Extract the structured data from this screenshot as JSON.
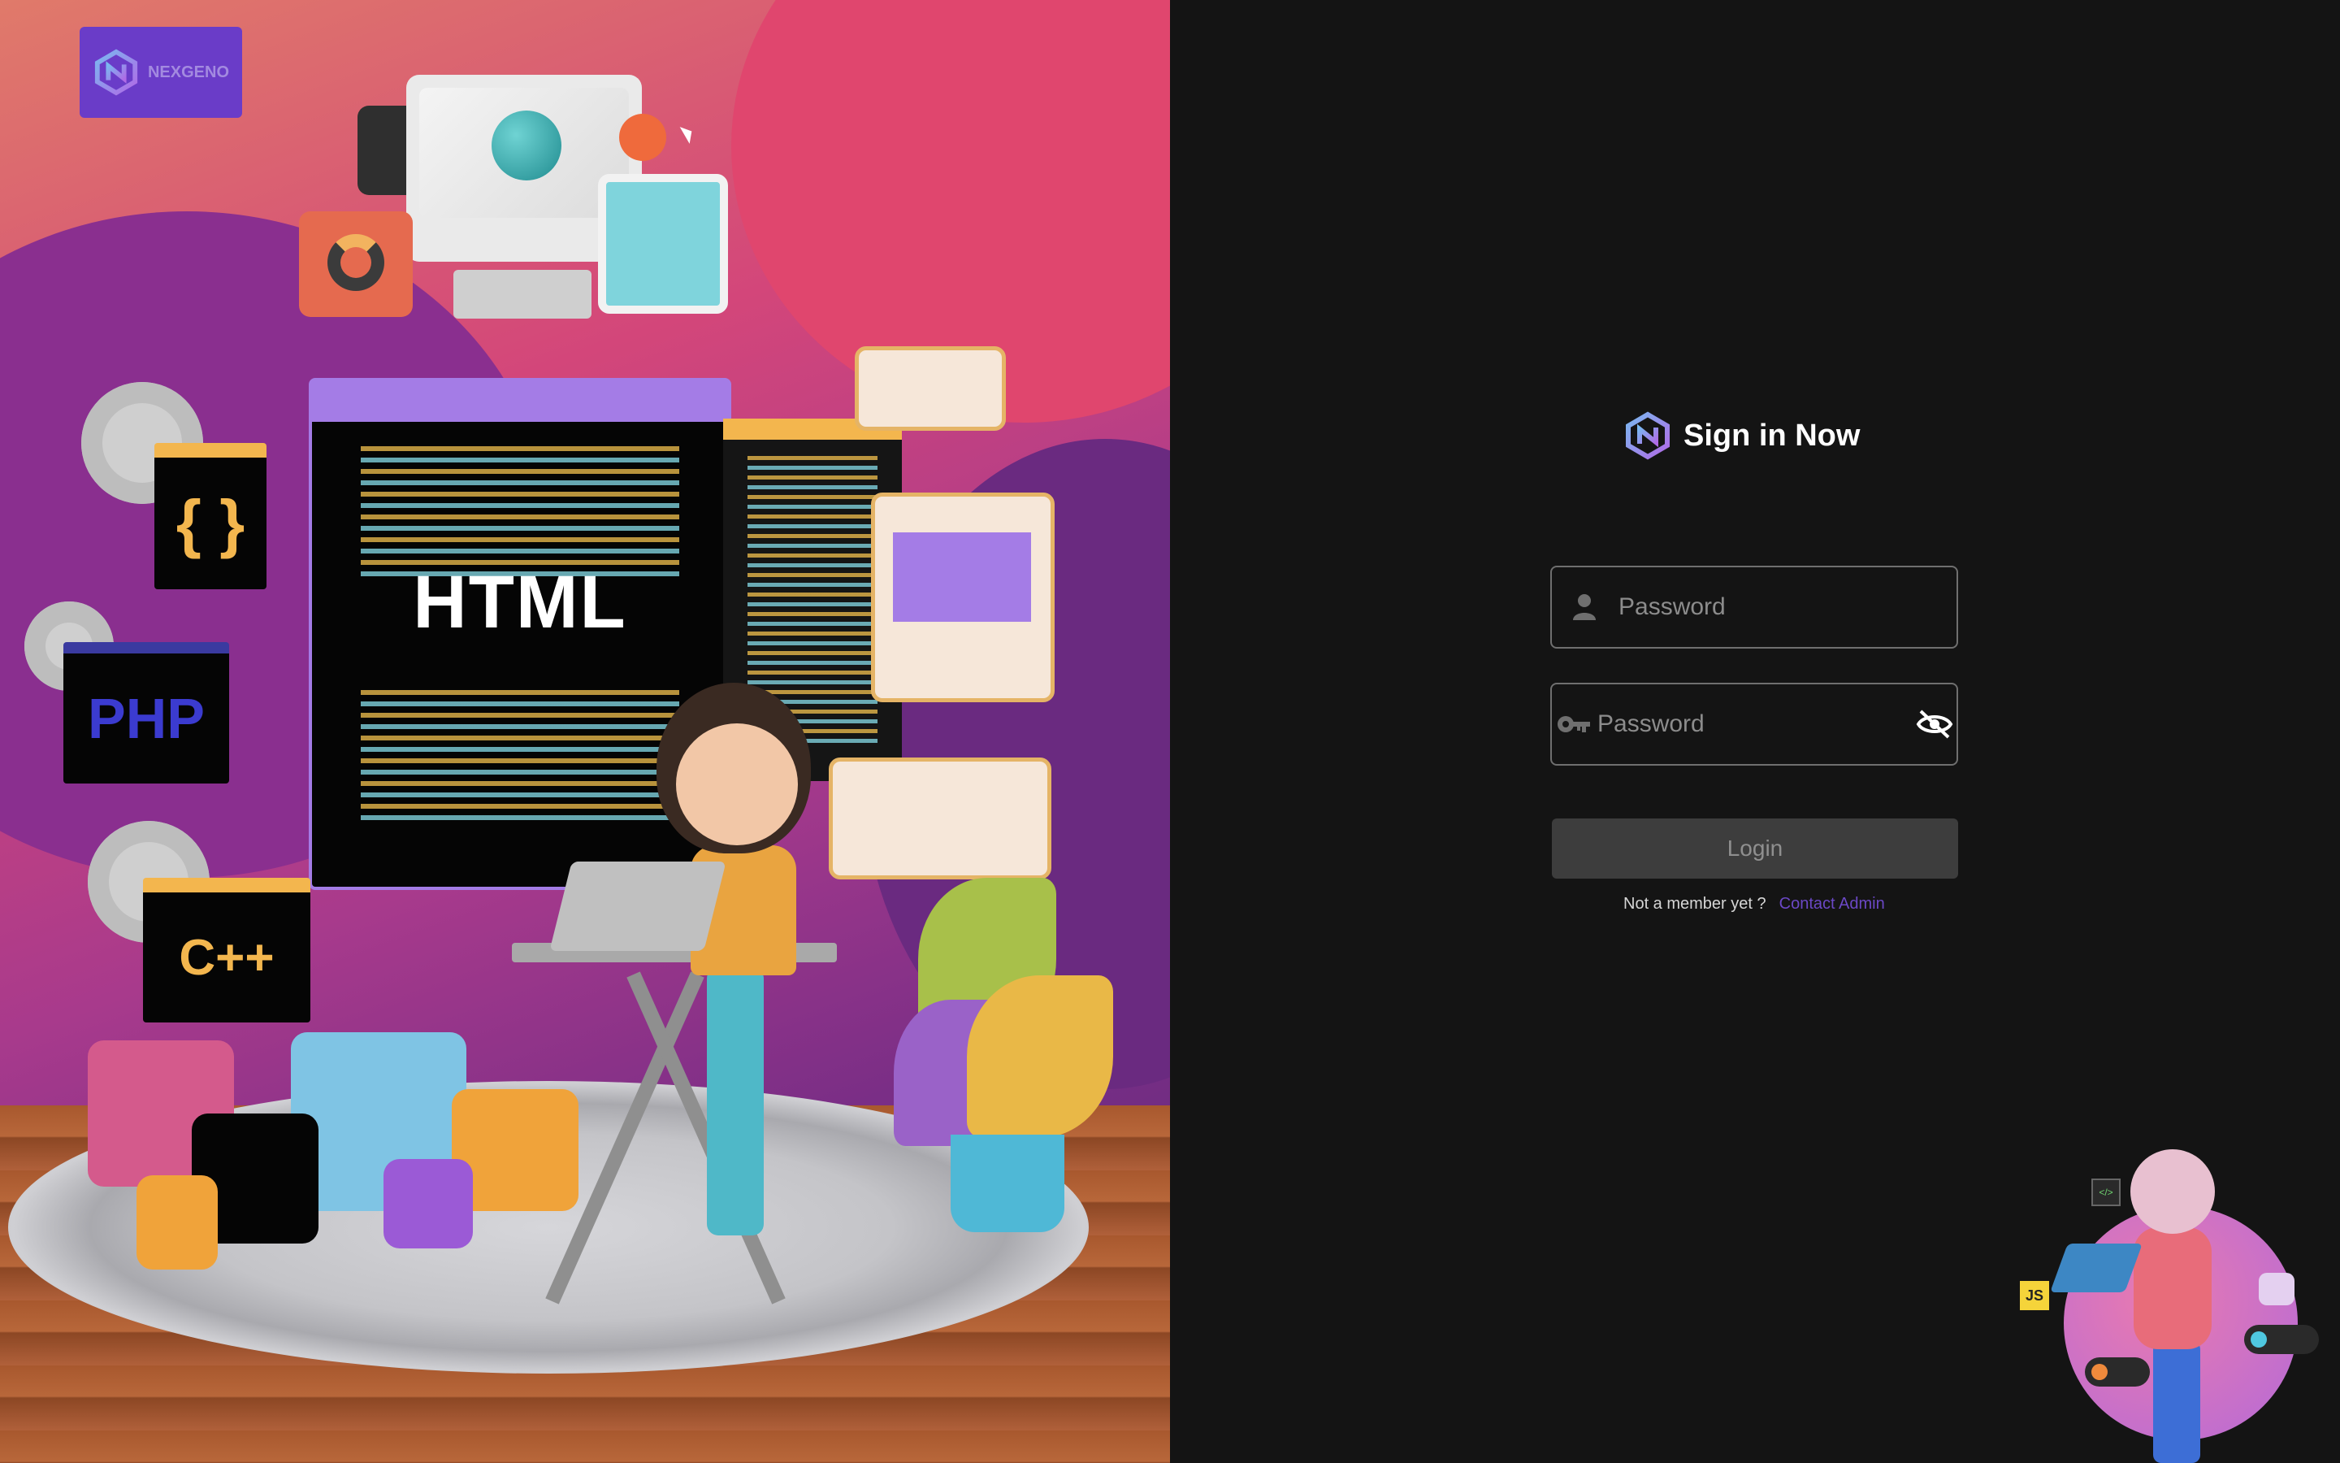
{
  "brand": {
    "name": "NEXGENO"
  },
  "illustration": {
    "html_label": "HTML",
    "php_label": "PHP",
    "cpp_label": "C++",
    "braces_label": "{ }"
  },
  "login": {
    "title": "Sign in Now",
    "username_placeholder": "Password",
    "password_placeholder": "Password",
    "login_button": "Login",
    "signup_prompt": "Not a member yet ?",
    "contact_link": "Contact Admin"
  },
  "decor": {
    "js_badge": "JS",
    "code_badge": "</>"
  },
  "colors": {
    "background": "#141414",
    "accent": "#6b48c6",
    "brand_box": "#6a3cc8",
    "button_bg": "#3d3d3d"
  },
  "icons": {
    "user_field": "user-icon",
    "password_field": "key-icon",
    "toggle": "eye-off-icon",
    "logo": "nexgeno-logo-icon"
  }
}
